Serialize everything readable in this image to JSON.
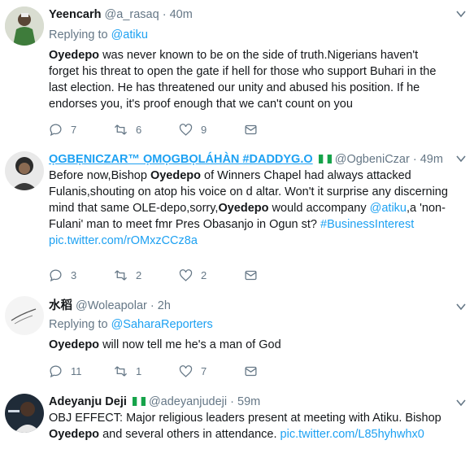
{
  "tweets": [
    {
      "name": "Yeencarh",
      "handle": "@a_rasaq",
      "time": "40m",
      "replying_prefix": "Replying to",
      "replying_to": "@atiku",
      "bold": "Oyedepo",
      "text": " was never known to be on the side of truth.Nigerians haven't forget his threat to open the gate if hell for those who support Buhari in the last election. He has threatened our unity and abused his position. If he endorses you, it's proof enough that we can't count on you",
      "replies": "7",
      "retweets": "6",
      "likes": "9"
    },
    {
      "name": "ỌGBẸNICZAR™ ỌMỌGBỌLÁHÀN #DADDYG.O",
      "handle": "@OgbeniCzar",
      "time": "49m",
      "text_pre": "Before now,Bishop ",
      "bold1": "Oyedepo",
      "text_mid1": " of Winners Chapel had always attacked Fulanis,shouting on atop his voice on d altar. Won't it  surprise any discerning mind that same OLE-depo,sorry,",
      "bold2": "Oyedepo",
      "text_mid2": " would accompany ",
      "link1": "@atiku",
      "text_mid3": ",a 'non-Fulani' man to meet fmr Pres Obasanjo in Ogun st? ",
      "link2": "#BusinessInterest",
      "link3": "pic.twitter.com/rOMxzCCz8a",
      "replies": "3",
      "retweets": "2",
      "likes": "2"
    },
    {
      "name": "水稻",
      "handle": "@Woleapolar",
      "time": "2h",
      "replying_prefix": "Replying to",
      "replying_to": "@SaharaReporters",
      "bold": "Oyedepo",
      "text": " will now tell me he's a man of God",
      "replies": "11",
      "retweets": "1",
      "likes": "7"
    },
    {
      "name": "Adeyanju Deji",
      "handle": "@adeyanjudeji",
      "time": "59m",
      "text_pre": "OBJ EFFECT: Major religious leaders present at meeting with Atiku. Bishop ",
      "bold1": "Oyedepo",
      "text_mid1": " and several others in attendance. ",
      "link1": "pic.twitter.com/L85hyhwhx0"
    }
  ],
  "dot": "·",
  "colors": {
    "link": "#1da1f2",
    "muted": "#657786",
    "border": "#e6ecf0"
  }
}
